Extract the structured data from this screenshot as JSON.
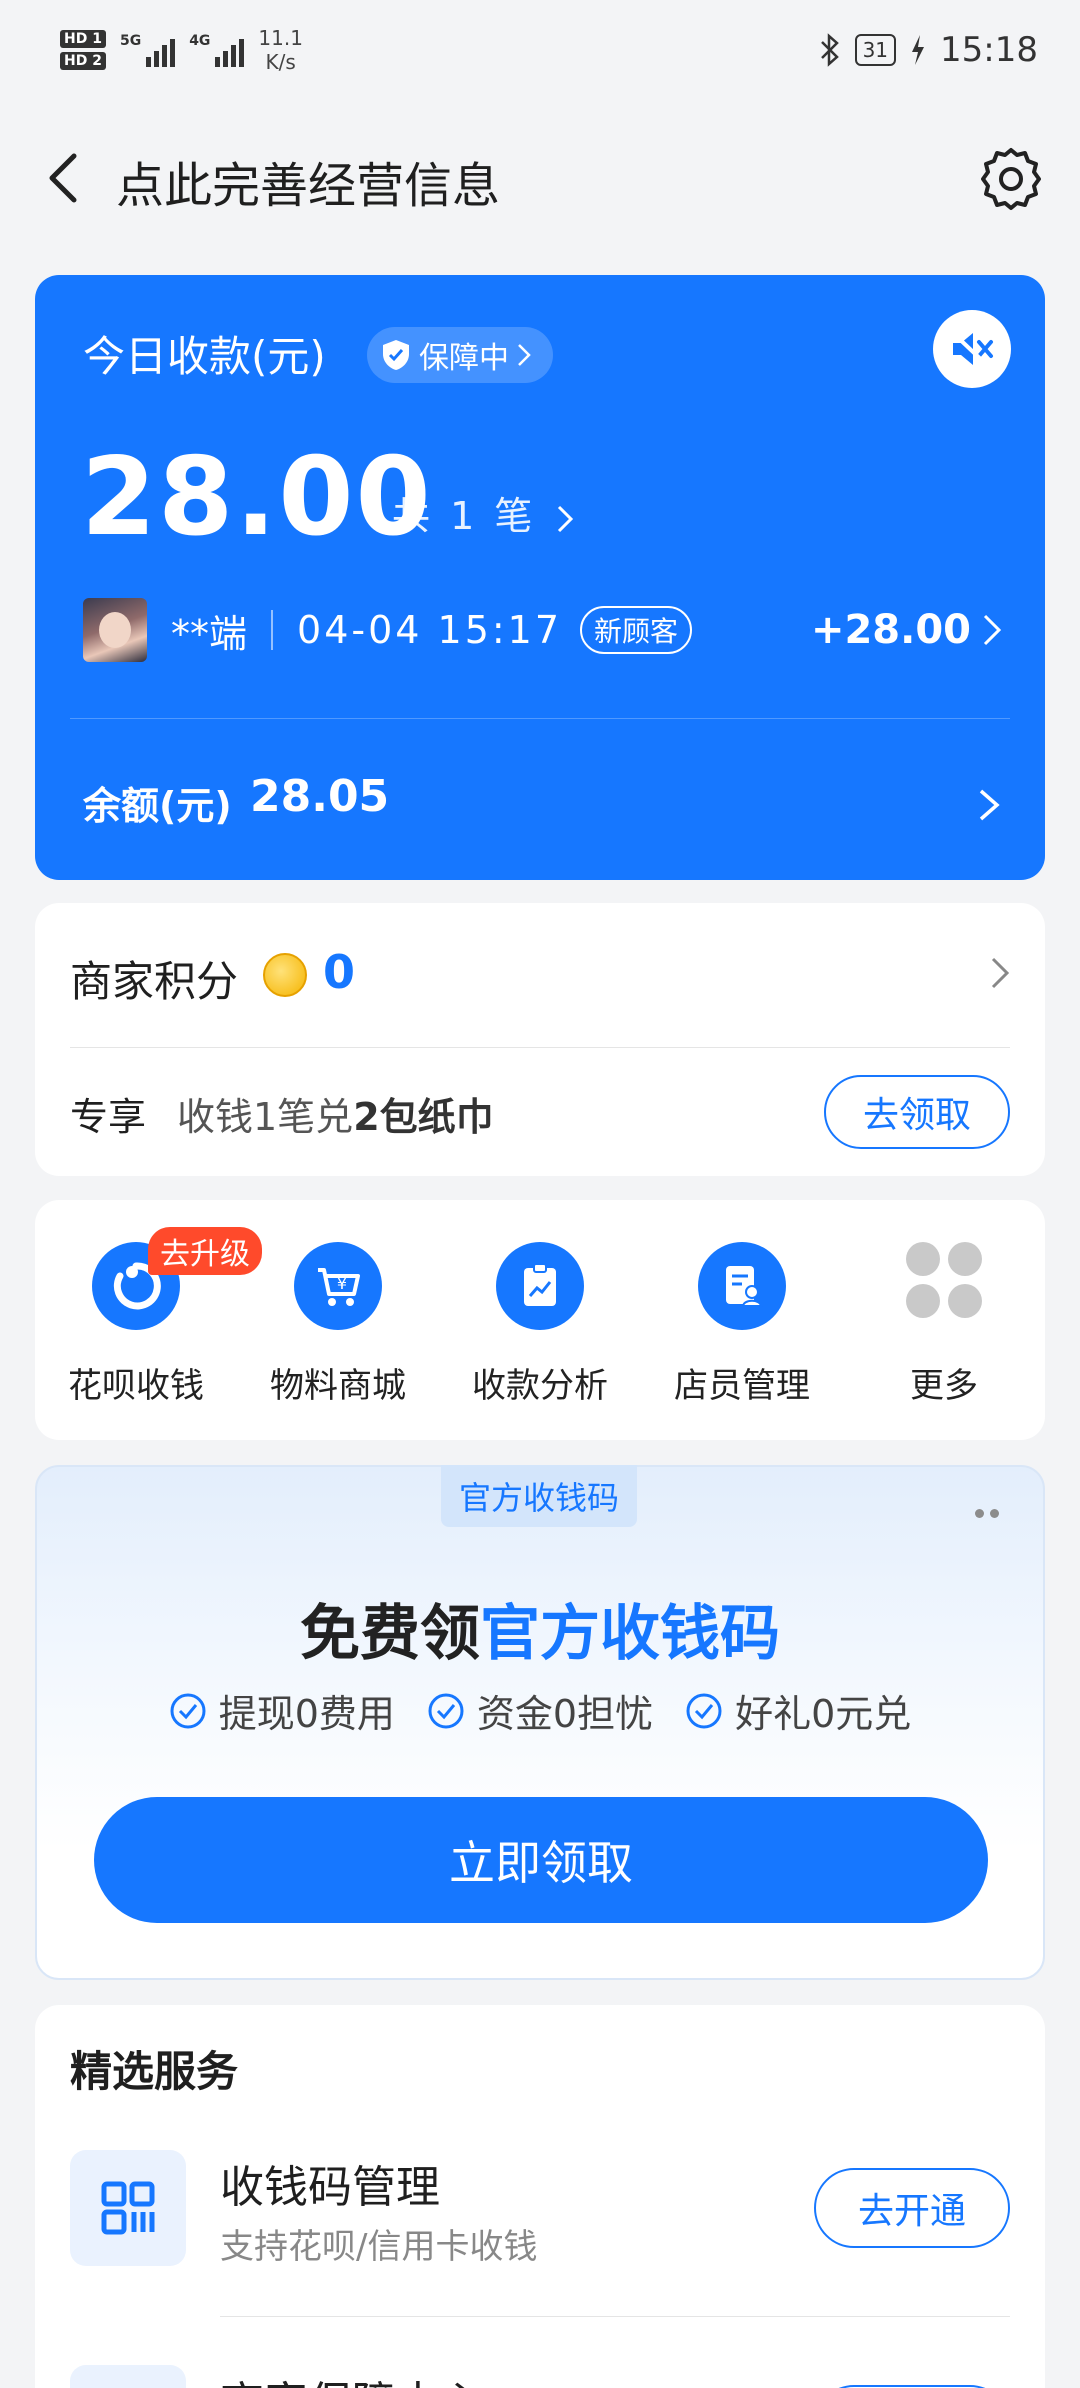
{
  "status_bar": {
    "hd1": "HD 1",
    "hd2": "HD 2",
    "net1": "5G",
    "net2": "4G",
    "speed_value": "11.1",
    "speed_unit": "K/s",
    "battery": "31",
    "time": "15:18"
  },
  "header": {
    "title": "点此完善经营信息"
  },
  "today": {
    "label": "今日收款(元)",
    "guard_label": "保障中",
    "amount": "28.00",
    "count_text": "共 1 笔",
    "payer": "**端",
    "time": "04-04 15:17",
    "new_customer_tag": "新顾客",
    "plus_amount": "+28.00",
    "balance_label": "余额(元)",
    "balance": "28.05"
  },
  "points": {
    "label": "商家积分",
    "value": "0",
    "perk_label": "专享",
    "perk_text_a": "收钱1笔兑",
    "perk_text_b": "2包纸巾",
    "perk_button": "去领取"
  },
  "tools": {
    "upgrade_badge": "去升级",
    "items": [
      {
        "label": "花呗收钱"
      },
      {
        "label": "物料商城"
      },
      {
        "label": "收款分析"
      },
      {
        "label": "店员管理"
      },
      {
        "label": "更多"
      }
    ]
  },
  "promo": {
    "tag": "官方收钱码",
    "title_a": "免费领",
    "title_b": "官方收钱码",
    "checks": [
      "提现0费用",
      "资金0担忧",
      "好礼0元兑"
    ],
    "button": "立即领取"
  },
  "services": {
    "title": "精选服务",
    "items": [
      {
        "name": "收钱码管理",
        "desc": "支持花呗/信用卡收钱",
        "button": "去开通"
      },
      {
        "name": "商家保障中心"
      }
    ]
  },
  "colors": {
    "accent": "#1677ff",
    "badge": "#ff4a2b",
    "background": "#f3f4f6"
  }
}
